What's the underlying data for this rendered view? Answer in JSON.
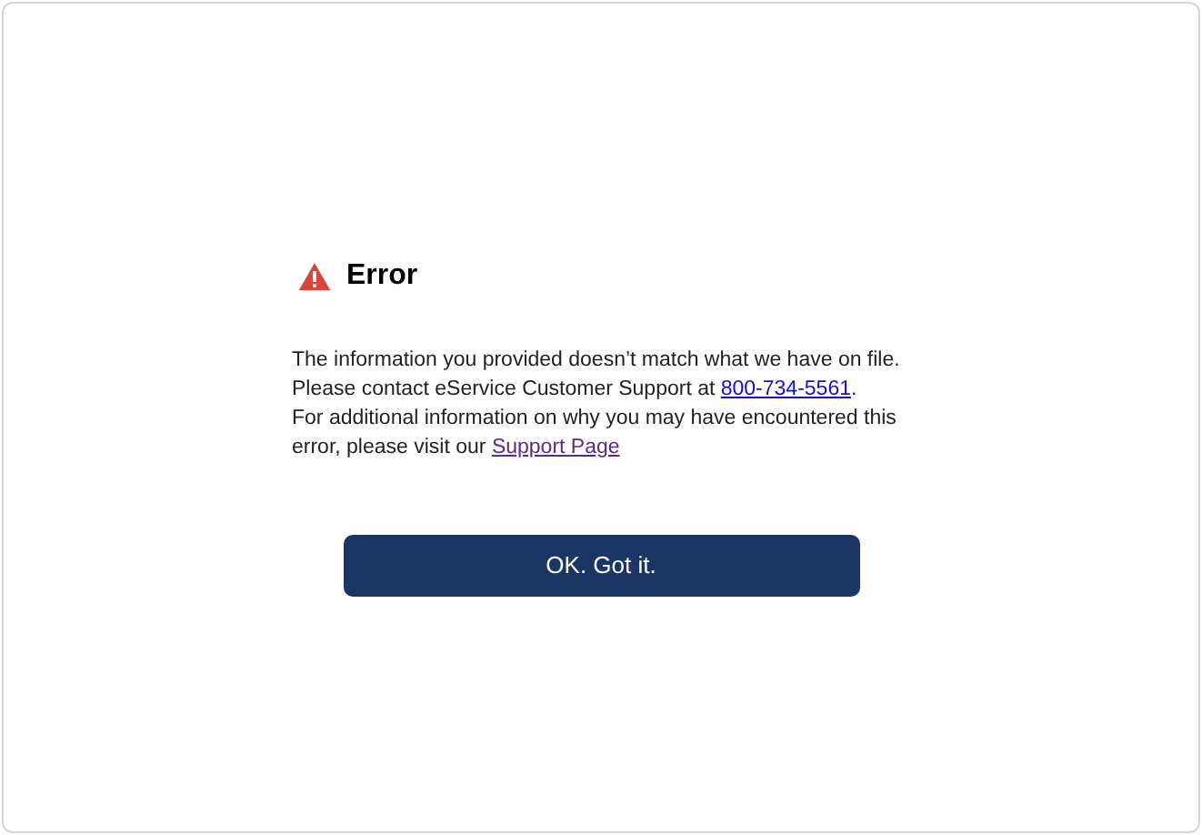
{
  "dialog": {
    "title": "Error",
    "paragraphs": [
      {
        "text": "The information you provided doesn’t match what we have on file."
      },
      {
        "text": "Please contact eService Customer Support at ",
        "link": {
          "text": "800-734-5561",
          "visited": false
        },
        "after": "."
      },
      {
        "text": "For additional information on why you may have encountered this error, please visit our ",
        "link": {
          "text": "Support Page",
          "visited": true
        }
      }
    ],
    "button": "OK. Got it."
  }
}
